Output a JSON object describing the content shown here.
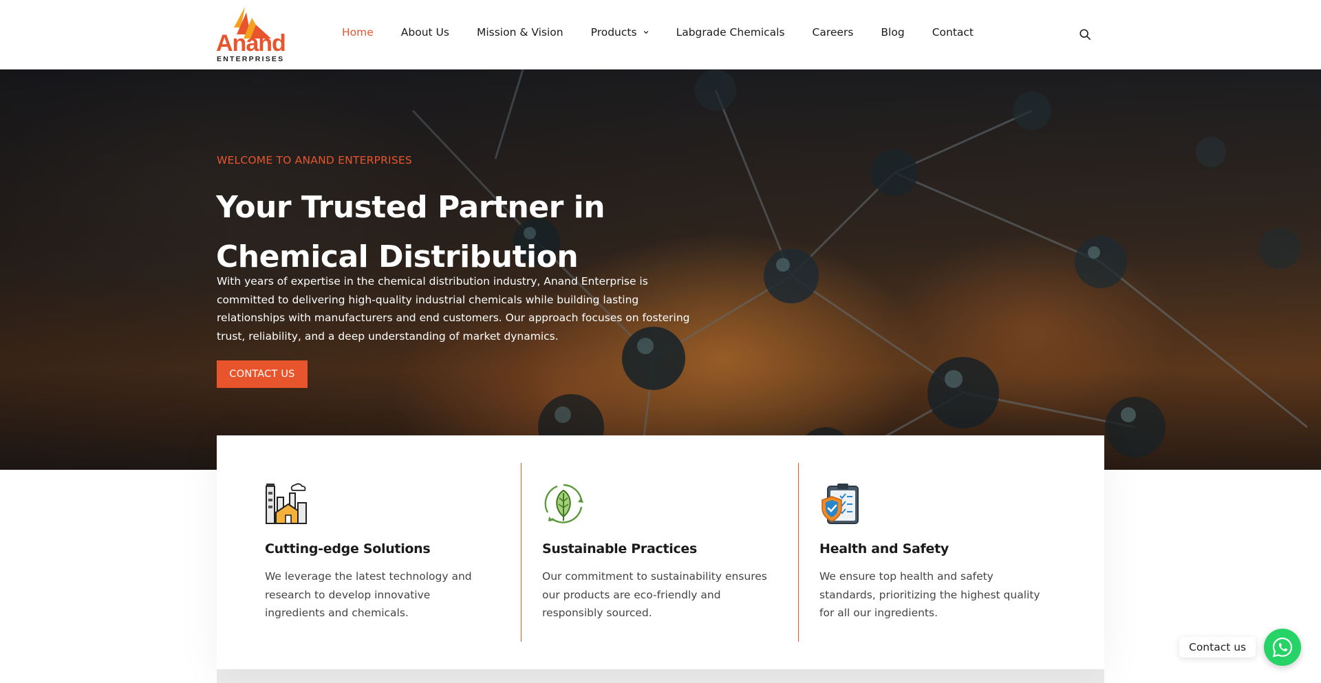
{
  "brand": {
    "name": "Anand",
    "subtitle": "ENTERPRISES",
    "primary_color": "#e8552d",
    "accent_color": "#f4a21e"
  },
  "nav": {
    "items": [
      {
        "label": "Home",
        "active": true
      },
      {
        "label": "About Us"
      },
      {
        "label": "Mission & Vision"
      },
      {
        "label": "Products",
        "has_dropdown": true
      },
      {
        "label": "Labgrade Chemicals"
      },
      {
        "label": "Careers"
      },
      {
        "label": "Blog"
      },
      {
        "label": "Contact"
      }
    ],
    "search_icon": "search-icon"
  },
  "hero": {
    "eyebrow": "WELCOME TO ANAND ENTERPRISES",
    "title": "Your Trusted Partner in Chemical Distribution",
    "text": "With years of expertise in the chemical distribution industry, Anand Enterprise is committed to delivering high-quality industrial chemicals while building lasting relationships with manufacturers and end customers. Our approach focuses on fostering trust, reliability, and a deep understanding of market dynamics.",
    "button": "CONTACT US"
  },
  "features": [
    {
      "icon": "factory-icon",
      "title": "Cutting-edge Solutions",
      "description": "We leverage the latest technology and research to develop innovative ingredients and chemicals."
    },
    {
      "icon": "leaf-icon",
      "title": "Sustainable Practices",
      "description": "Our commitment to sustainability ensures our products are eco-friendly and responsibly sourced."
    },
    {
      "icon": "safety-checklist-icon",
      "title": "Health and Safety",
      "description": "We ensure top health and safety standards, prioritizing the highest quality for all our ingredients."
    }
  ],
  "floating": {
    "contact_label": "Contact us",
    "whatsapp_icon": "whatsapp-icon"
  }
}
